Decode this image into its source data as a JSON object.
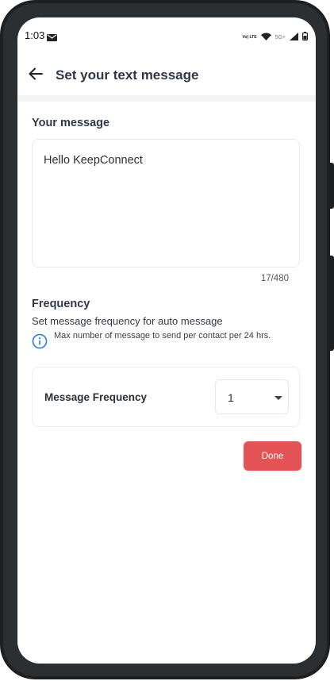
{
  "status_bar": {
    "time": "1:03",
    "network_label": "Vo) LTE",
    "fiveg_label": "5G+",
    "icons": [
      "mail-icon",
      "volte-icon",
      "wifi-icon",
      "signal-icon",
      "battery-icon"
    ]
  },
  "header": {
    "title": "Set your text message",
    "back_icon": "arrow-left-icon"
  },
  "message": {
    "section_label": "Your message",
    "value": "Hello KeepConnect",
    "char_count": "17/480"
  },
  "frequency": {
    "title": "Frequency",
    "description": "Set message frequency for auto message",
    "info_icon": "info-circle-icon",
    "info_text": "Max number of message to send per contact per 24 hrs.",
    "field_label": "Message Frequency",
    "selected_value": "1"
  },
  "actions": {
    "done_label": "Done"
  },
  "colors": {
    "accent": "#e45457",
    "info_blue": "#2c7be5",
    "title_text": "#2e3747"
  }
}
